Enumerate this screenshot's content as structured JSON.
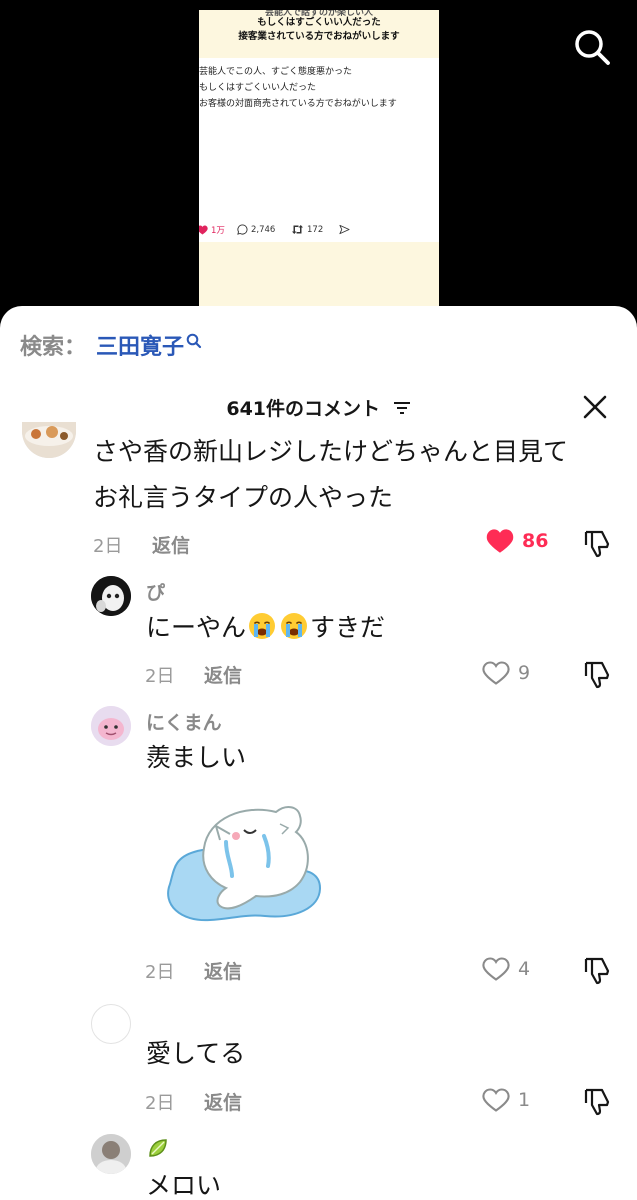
{
  "video": {
    "post_banner_cut": "芸能人で話すのが楽しい人",
    "post_banner_line1": "もしくはすごくいい人だった",
    "post_banner_line2": "接客業されている方でおねがいします",
    "post_lines": [
      "芸能人でこの人、すごく態度悪かった",
      "もしくはすごくいい人だった",
      "お客様の対面商売されている方でおねがいします"
    ],
    "likes": "1万",
    "replies": "2,746",
    "reposts": "172"
  },
  "search": {
    "label": "検索：",
    "term": "三田寛子"
  },
  "header": {
    "title": "641件のコメント"
  },
  "comments": [
    {
      "text_line1": "さや香の新山レジしたけどちゃんと目見て",
      "text_line2": "お礼言うタイプの人やった",
      "date": "2日",
      "reply_label": "返信",
      "likes": "86",
      "liked": true
    },
    {
      "username": "ぴ",
      "text_before": "にーやん",
      "emoji": "loudly-crying-face",
      "text_after": "すきだ",
      "date": "2日",
      "reply_label": "返信",
      "likes": "9"
    },
    {
      "username": "にくまん",
      "text": "羨ましい",
      "sticker": "crying-cat-sticker",
      "date": "2日",
      "reply_label": "返信",
      "likes": "4"
    },
    {
      "username": "",
      "text": "愛してる",
      "date": "2日",
      "reply_label": "返信",
      "likes": "1"
    },
    {
      "username_emoji": "lime",
      "text": "メロい"
    }
  ],
  "colors": {
    "accent_red": "#fe2c55",
    "search_blue": "#2a58b7",
    "muted_gray": "#8a8a8a",
    "banner_cream": "#fdf7df"
  }
}
